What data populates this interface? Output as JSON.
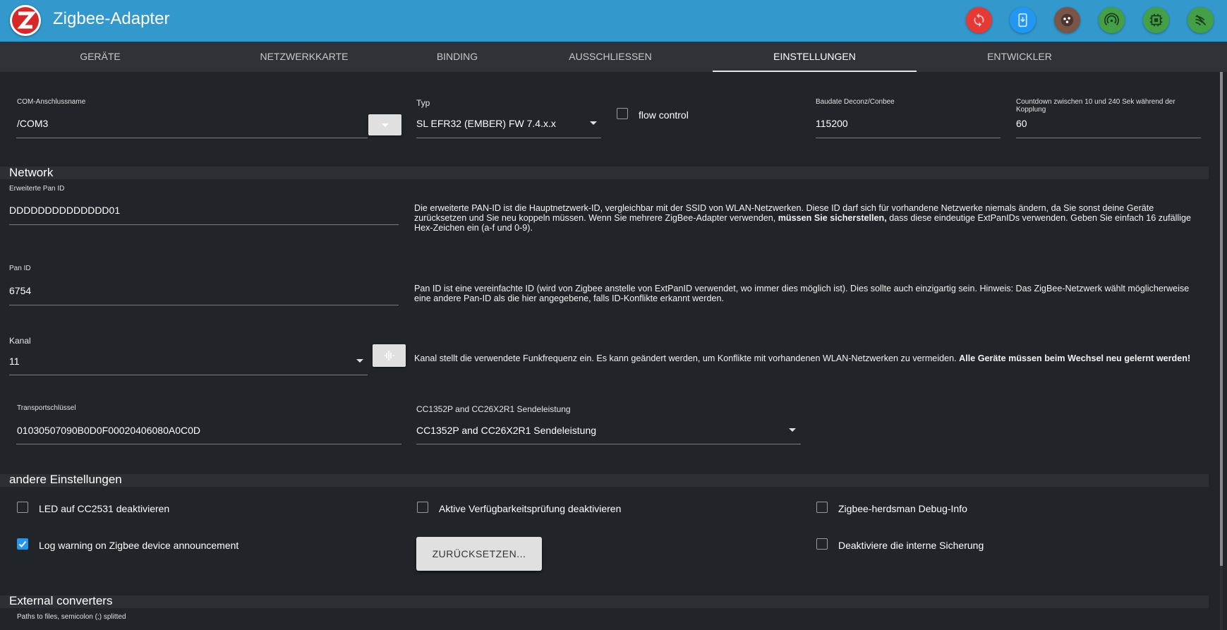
{
  "header": {
    "title": "Zigbee-Adapter",
    "buttons": [
      {
        "icon": "sync-icon",
        "color": "#e53935"
      },
      {
        "icon": "download-icon",
        "color": "#2196f3"
      },
      {
        "icon": "cookie-icon",
        "color": "#795548"
      },
      {
        "icon": "signal-icon",
        "color": "#43a047"
      },
      {
        "icon": "chip-icon",
        "color": "#43a047"
      },
      {
        "icon": "zigbee-icon",
        "color": "#43a047"
      }
    ]
  },
  "tabs": [
    "GERÄTE",
    "NETZWERKKARTE",
    "BINDING",
    "AUSSCHLIESSEN",
    "EINSTELLUNGEN",
    "ENTWICKLER"
  ],
  "active_tab": "EINSTELLUNGEN",
  "com": {
    "label": "COM-Anschlussname",
    "value": "/COM3"
  },
  "typ": {
    "label": "Typ",
    "value": "SL EFR32 (EMBER) FW 7.4.x.x"
  },
  "flow_control": {
    "label": "flow control",
    "checked": false
  },
  "baud": {
    "label": "Baudate Deconz/Conbee",
    "value": "115200"
  },
  "countdown": {
    "label": "Countdown zwischen 10 und 240 Sek während der Kopplung",
    "value": "60"
  },
  "network": {
    "title": "Network",
    "ext_pan": {
      "label": "Erweiterte Pan ID",
      "value": "DDDDDDDDDDDDDD01",
      "desc_1": "Die erweiterte PAN-ID ist die Hauptnetzwerk-ID, vergleichbar mit der SSID von WLAN-Netzwerken. Diese ID darf sich für vorhandene Netzwerke niemals ändern, da Sie sonst deine Geräte zurücksetzen und Sie neu koppeln müssen. Wenn Sie mehrere ZigBee-Adapter verwenden, ",
      "desc_bold": "müssen Sie sicherstellen,",
      "desc_2": " dass diese eindeutige ExtPanIDs verwenden. Geben Sie einfach 16 zufällige Hex-Zeichen ein (a-f und 0-9)."
    },
    "pan": {
      "label": "Pan ID",
      "value": "6754",
      "desc": "Pan ID ist eine vereinfachte ID (wird von Zigbee anstelle von ExtPanID verwendet, wo immer dies möglich ist). Dies sollte auch einzigartig sein. Hinweis: Das ZigBee-Netzwerk wählt möglicherweise eine andere Pan-ID als die hier angegebene, falls ID-Konflikte erkannt werden."
    },
    "kanal": {
      "label": "Kanal",
      "value": "11",
      "desc_1": "Kanal stellt die verwendete Funkfrequenz ein. Es kann geändert werden, um Konflikte mit vorhandenen WLAN-Netzwerken zu vermeiden. ",
      "desc_bold": "Alle Geräte müssen beim Wechsel neu gelernt werden!"
    },
    "transport": {
      "label": "Transportschlüssel",
      "value": "01030507090B0D0F00020406080A0C0D"
    },
    "cc": {
      "label": "CC1352P and CC26X2R1 Sendeleistung",
      "value": "CC1352P and CC26X2R1 Sendeleistung"
    }
  },
  "other": {
    "title": "andere Einstellungen",
    "led": {
      "label": "LED auf CC2531 deaktivieren",
      "checked": false
    },
    "avail": {
      "label": "Aktive Verfügbarkeitsprüfung deaktivieren",
      "checked": false
    },
    "debug": {
      "label": "Zigbee-herdsman Debug-Info",
      "checked": false
    },
    "log_warning": {
      "label": "Log warning on Zigbee device announcement",
      "checked": true
    },
    "reset_button": "ZURÜCKSETZEN...",
    "backup": {
      "label": "Deaktiviere die interne Sicherung",
      "checked": false
    }
  },
  "external": {
    "title": "External converters",
    "label": "Paths to files, semicolon (;) splitted"
  }
}
